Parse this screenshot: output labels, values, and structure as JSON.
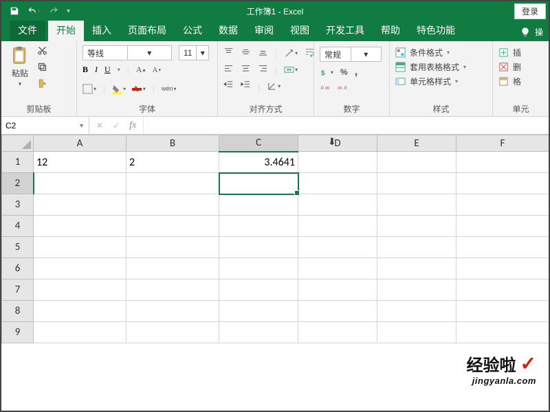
{
  "titlebar": {
    "title": "工作簿1 - Excel",
    "login": "登录"
  },
  "tabs": {
    "file": "文件",
    "items": [
      "开始",
      "插入",
      "页面布局",
      "公式",
      "数据",
      "审阅",
      "视图",
      "开发工具",
      "帮助",
      "特色功能"
    ],
    "active_index": 0,
    "tellme": "操"
  },
  "ribbon": {
    "clipboard": {
      "paste": "粘贴",
      "label": "剪贴板"
    },
    "font": {
      "name": "等线",
      "size": "11",
      "bold": "B",
      "italic": "I",
      "underline": "U",
      "pinyin": "wén",
      "label": "字体"
    },
    "align": {
      "label": "对齐方式"
    },
    "number": {
      "format": "常规",
      "label": "数字"
    },
    "styles": {
      "cond": "条件格式",
      "table": "套用表格格式",
      "cell": "单元格样式",
      "label": "样式"
    },
    "cells": {
      "label": "单元"
    }
  },
  "fbar": {
    "name": "C2",
    "formula": ""
  },
  "grid": {
    "columns": [
      "A",
      "B",
      "C",
      "D",
      "E",
      "F"
    ],
    "row_headers": [
      "1",
      "2",
      "3",
      "4",
      "5",
      "6",
      "7",
      "8",
      "9"
    ],
    "selected_cell": "C2",
    "insert_marker_col": "D",
    "cells": {
      "A1": "12",
      "B1": "2",
      "C1": "3.4641"
    }
  },
  "watermark": {
    "text": "经验啦",
    "sub": "jingyanla.com"
  },
  "colors": {
    "brand": "#107c41"
  }
}
